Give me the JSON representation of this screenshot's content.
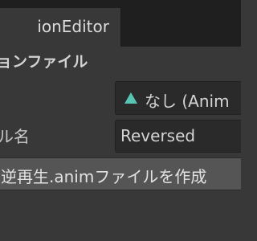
{
  "tab": {
    "title": "ionEditor"
  },
  "section": {
    "title": "ョンファイル"
  },
  "source_field": {
    "icon": "animation-clip-icon",
    "value": "なし (Anim"
  },
  "name_row": {
    "label": "ル名",
    "value": "Reversed"
  },
  "create_button": {
    "label": "逆再生.animファイルを作成"
  },
  "colors": {
    "background": "#383838",
    "tabbar": "#1f1f1f",
    "field": "#2a2a2a",
    "button": "#555555",
    "icon": "#58c4b4"
  }
}
